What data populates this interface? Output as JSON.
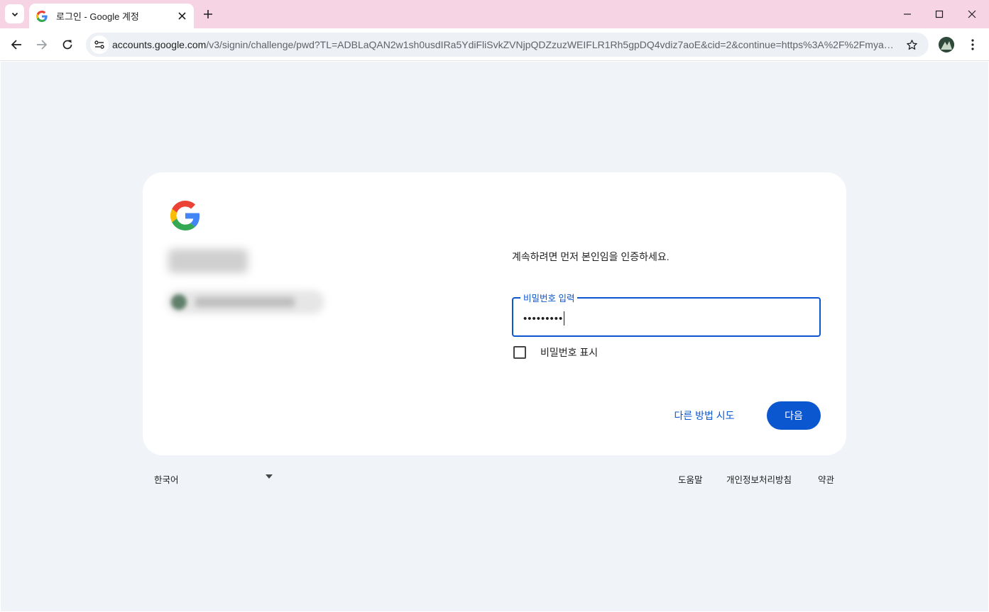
{
  "browser": {
    "tab": {
      "title": "로그인 - Google 계정"
    },
    "address_bar": {
      "url_host": "accounts.google.com",
      "url_path": "/v3/signin/challenge/pwd?TL=ADBLaQAN2w1sh0usdIRa5YdiFliSvkZVNjpQDZzuzWEIFLR1Rh5gpDQ4vdiz7aoE&cid=2&continue=https%3A%2F%2Fmyac..."
    },
    "icons": [
      "tab-search-icon",
      "google-favicon-icon",
      "close-icon",
      "plus-icon",
      "minimize-icon",
      "maximize-icon",
      "close-window-icon",
      "back-arrow-icon",
      "forward-arrow-icon",
      "reload-icon",
      "site-info-icon",
      "star-icon",
      "profile-avatar-icon",
      "more-vert-icon"
    ]
  },
  "signin": {
    "prompt": "계속하려면 먼저 본인임을 인증하세요.",
    "password_label": "비밀번호 입력",
    "password_value": "•••••••••",
    "show_password_label": "비밀번호 표시",
    "try_another_label": "다른 방법 시도",
    "next_label": "다음"
  },
  "footer": {
    "language": "한국어",
    "help": "도움말",
    "privacy": "개인정보처리방침",
    "terms": "약관"
  },
  "colors": {
    "tabstrip": "#f6d4e3",
    "page_bg": "#f0f4f9",
    "accent": "#0b57d0"
  }
}
